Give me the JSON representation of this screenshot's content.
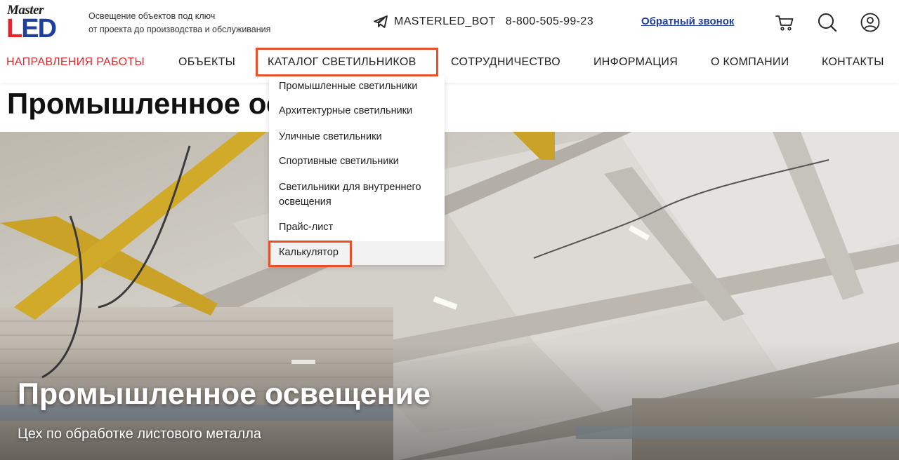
{
  "header": {
    "logo": {
      "line1": "Master",
      "led_l": "L",
      "led_ed": "ED"
    },
    "tagline": [
      "Освещение объектов под ключ",
      "от проекта до производства и обслуживания"
    ],
    "telegram_icon": "telegram-plane-icon",
    "bot": "MASTERLED_BOT",
    "phone": "8-800-505-99-23",
    "callback": "Обратный звонок",
    "icons": [
      "cart-icon",
      "search-icon",
      "user-icon"
    ]
  },
  "nav": {
    "items": [
      {
        "label": "НАПРАВЛЕНИЯ РАБОТЫ",
        "active": true
      },
      {
        "label": "ОБЪЕКТЫ"
      },
      {
        "label": "КАТАЛОГ СВЕТИЛЬНИКОВ"
      },
      {
        "label": "СОТРУДНИЧЕСТВО"
      },
      {
        "label": "ИНФОРМАЦИЯ"
      },
      {
        "label": "О КОМПАНИИ"
      },
      {
        "label": "КОНТАКТЫ"
      }
    ]
  },
  "dropdown": {
    "items": [
      {
        "label": "Промышленные светильники"
      },
      {
        "label": "Архитектурные светильники"
      },
      {
        "label": "Уличные светильники"
      },
      {
        "label": "Спортивные светильники"
      },
      {
        "label_line1": "Светильники для внутреннего",
        "label_line2": "освещения"
      },
      {
        "label": "Прайс-лист"
      },
      {
        "label": "Калькулятор"
      }
    ]
  },
  "page": {
    "title": "Промышленное освещение"
  },
  "hero": {
    "title": "Промышленное освещение",
    "subtitle": "Цех по обработке листового металла"
  },
  "colors": {
    "accent_red": "#e3262c",
    "brand_blue": "#1f3f9e",
    "highlight_orange": "#e8502a"
  }
}
